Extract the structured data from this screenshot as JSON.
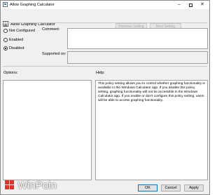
{
  "window": {
    "title": "Allow Graphing Calculator",
    "controls": {
      "minimize": "–",
      "close": "✕"
    }
  },
  "header": {
    "policy_name": "Allow Graphing Calculator",
    "prev_label": "Previous Setting",
    "next_label": "Next Setting"
  },
  "state": {
    "options": [
      {
        "label": "Not Configured",
        "selected": false
      },
      {
        "label": "Enabled",
        "selected": false
      },
      {
        "label": "Disabled",
        "selected": true
      }
    ]
  },
  "fields": {
    "comment_label": "Comment:",
    "comment_value": "",
    "supported_label": "Supported on:",
    "supported_value": ""
  },
  "sections": {
    "options_label": "Options:",
    "help_label": "Help:",
    "help_text": "This policy setting allows you to control whether graphing functionality is available in the Windows Calculator app. If you disable this policy setting, graphing functionality will not be accessible in the Windows Calculator app. If you enable or don't configure this policy setting, users will be able to access graphing functionality."
  },
  "buttons": {
    "ok": "OK",
    "cancel": "Cancel",
    "apply": "Apply"
  },
  "watermark": {
    "text": "WinPoin",
    "color": "#e8302a"
  }
}
